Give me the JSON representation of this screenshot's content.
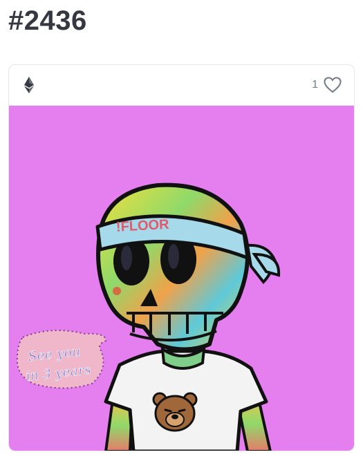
{
  "item": {
    "title": "#2436",
    "chain_icon": "ethereum-icon",
    "like_count": "1",
    "like_icon": "heart-outline-icon"
  },
  "artwork": {
    "background_color": "#e57ff0",
    "headband_text": "!FLOOR",
    "sticker_line1": "See you",
    "sticker_line2": "in 3 years"
  }
}
